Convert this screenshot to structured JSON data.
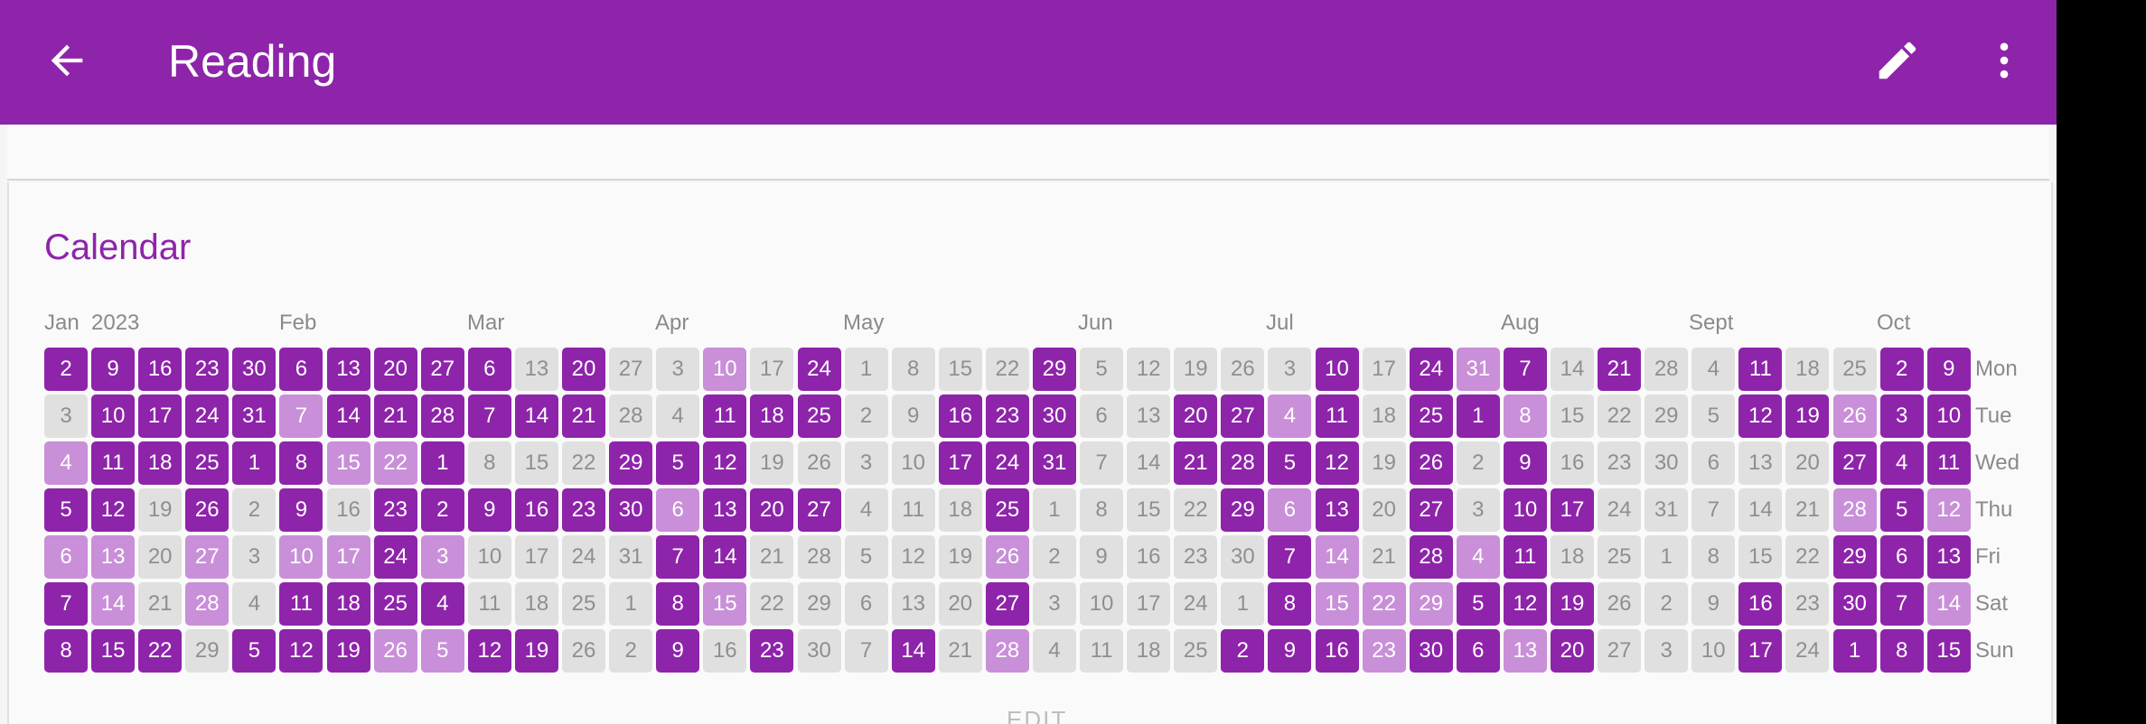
{
  "appbar": {
    "title": "Reading",
    "back_icon": "arrow-back-icon",
    "edit_icon": "pencil-icon",
    "more_icon": "more-vert-icon",
    "color": "#8e24aa"
  },
  "calendar": {
    "title": "Calendar",
    "year": "2023",
    "months": [
      "Jan",
      "Feb",
      "Mar",
      "Apr",
      "May",
      "Jun",
      "Jul",
      "Aug",
      "Sept",
      "Oct"
    ],
    "weekdays": [
      "Mon",
      "Tue",
      "Wed",
      "Thu",
      "Fri",
      "Sat",
      "Sun"
    ],
    "colors": {
      "done": "#8e24aa",
      "partial": "#c98fd8",
      "none": "#e0e0e0"
    },
    "levels_legend": "0 = not done (grey), 1 = partial (light purple), 2 = done (purple)",
    "weeks": [
      [
        [
          2,
          2
        ],
        [
          3,
          0
        ],
        [
          4,
          1
        ],
        [
          5,
          2
        ],
        [
          6,
          1
        ],
        [
          7,
          2
        ],
        [
          8,
          2
        ]
      ],
      [
        [
          9,
          2
        ],
        [
          10,
          2
        ],
        [
          11,
          2
        ],
        [
          12,
          2
        ],
        [
          13,
          1
        ],
        [
          14,
          1
        ],
        [
          15,
          2
        ]
      ],
      [
        [
          16,
          2
        ],
        [
          17,
          2
        ],
        [
          18,
          2
        ],
        [
          19,
          0
        ],
        [
          20,
          0
        ],
        [
          21,
          0
        ],
        [
          22,
          2
        ]
      ],
      [
        [
          23,
          2
        ],
        [
          24,
          2
        ],
        [
          25,
          2
        ],
        [
          26,
          2
        ],
        [
          27,
          1
        ],
        [
          28,
          1
        ],
        [
          29,
          0
        ]
      ],
      [
        [
          30,
          2
        ],
        [
          31,
          2
        ],
        [
          1,
          2
        ],
        [
          2,
          0
        ],
        [
          3,
          0
        ],
        [
          4,
          0
        ],
        [
          5,
          2
        ]
      ],
      [
        [
          6,
          2
        ],
        [
          7,
          1
        ],
        [
          8,
          2
        ],
        [
          9,
          2
        ],
        [
          10,
          1
        ],
        [
          11,
          2
        ],
        [
          12,
          2
        ]
      ],
      [
        [
          13,
          2
        ],
        [
          14,
          2
        ],
        [
          15,
          1
        ],
        [
          16,
          0
        ],
        [
          17,
          1
        ],
        [
          18,
          2
        ],
        [
          19,
          2
        ]
      ],
      [
        [
          20,
          2
        ],
        [
          21,
          2
        ],
        [
          22,
          1
        ],
        [
          23,
          2
        ],
        [
          24,
          2
        ],
        [
          25,
          2
        ],
        [
          26,
          1
        ]
      ],
      [
        [
          27,
          2
        ],
        [
          28,
          2
        ],
        [
          1,
          2
        ],
        [
          2,
          2
        ],
        [
          3,
          1
        ],
        [
          4,
          2
        ],
        [
          5,
          1
        ]
      ],
      [
        [
          6,
          2
        ],
        [
          7,
          2
        ],
        [
          8,
          0
        ],
        [
          9,
          2
        ],
        [
          10,
          0
        ],
        [
          11,
          0
        ],
        [
          12,
          2
        ]
      ],
      [
        [
          13,
          0
        ],
        [
          14,
          2
        ],
        [
          15,
          0
        ],
        [
          16,
          2
        ],
        [
          17,
          0
        ],
        [
          18,
          0
        ],
        [
          19,
          2
        ]
      ],
      [
        [
          20,
          2
        ],
        [
          21,
          2
        ],
        [
          22,
          0
        ],
        [
          23,
          2
        ],
        [
          24,
          0
        ],
        [
          25,
          0
        ],
        [
          26,
          0
        ]
      ],
      [
        [
          27,
          0
        ],
        [
          28,
          0
        ],
        [
          29,
          2
        ],
        [
          30,
          2
        ],
        [
          31,
          0
        ],
        [
          1,
          0
        ],
        [
          2,
          0
        ]
      ],
      [
        [
          3,
          0
        ],
        [
          4,
          0
        ],
        [
          5,
          2
        ],
        [
          6,
          1
        ],
        [
          7,
          2
        ],
        [
          8,
          2
        ],
        [
          9,
          2
        ]
      ],
      [
        [
          10,
          1
        ],
        [
          11,
          2
        ],
        [
          12,
          2
        ],
        [
          13,
          2
        ],
        [
          14,
          2
        ],
        [
          15,
          1
        ],
        [
          16,
          0
        ]
      ],
      [
        [
          17,
          0
        ],
        [
          18,
          2
        ],
        [
          19,
          0
        ],
        [
          20,
          2
        ],
        [
          21,
          0
        ],
        [
          22,
          0
        ],
        [
          23,
          2
        ]
      ],
      [
        [
          24,
          2
        ],
        [
          25,
          2
        ],
        [
          26,
          0
        ],
        [
          27,
          2
        ],
        [
          28,
          0
        ],
        [
          29,
          0
        ],
        [
          30,
          0
        ]
      ],
      [
        [
          1,
          0
        ],
        [
          2,
          0
        ],
        [
          3,
          0
        ],
        [
          4,
          0
        ],
        [
          5,
          0
        ],
        [
          6,
          0
        ],
        [
          7,
          0
        ]
      ],
      [
        [
          8,
          0
        ],
        [
          9,
          0
        ],
        [
          10,
          0
        ],
        [
          11,
          0
        ],
        [
          12,
          0
        ],
        [
          13,
          0
        ],
        [
          14,
          2
        ]
      ],
      [
        [
          15,
          0
        ],
        [
          16,
          2
        ],
        [
          17,
          2
        ],
        [
          18,
          0
        ],
        [
          19,
          0
        ],
        [
          20,
          0
        ],
        [
          21,
          0
        ]
      ],
      [
        [
          22,
          0
        ],
        [
          23,
          2
        ],
        [
          24,
          2
        ],
        [
          25,
          2
        ],
        [
          26,
          1
        ],
        [
          27,
          2
        ],
        [
          28,
          1
        ]
      ],
      [
        [
          29,
          2
        ],
        [
          30,
          2
        ],
        [
          31,
          2
        ],
        [
          1,
          0
        ],
        [
          2,
          0
        ],
        [
          3,
          0
        ],
        [
          4,
          0
        ]
      ],
      [
        [
          5,
          0
        ],
        [
          6,
          0
        ],
        [
          7,
          0
        ],
        [
          8,
          0
        ],
        [
          9,
          0
        ],
        [
          10,
          0
        ],
        [
          11,
          0
        ]
      ],
      [
        [
          12,
          0
        ],
        [
          13,
          0
        ],
        [
          14,
          0
        ],
        [
          15,
          0
        ],
        [
          16,
          0
        ],
        [
          17,
          0
        ],
        [
          18,
          0
        ]
      ],
      [
        [
          19,
          0
        ],
        [
          20,
          2
        ],
        [
          21,
          2
        ],
        [
          22,
          0
        ],
        [
          23,
          0
        ],
        [
          24,
          0
        ],
        [
          25,
          0
        ]
      ],
      [
        [
          26,
          0
        ],
        [
          27,
          2
        ],
        [
          28,
          2
        ],
        [
          29,
          2
        ],
        [
          30,
          0
        ],
        [
          1,
          0
        ],
        [
          2,
          2
        ]
      ],
      [
        [
          3,
          0
        ],
        [
          4,
          1
        ],
        [
          5,
          2
        ],
        [
          6,
          1
        ],
        [
          7,
          2
        ],
        [
          8,
          2
        ],
        [
          9,
          2
        ]
      ],
      [
        [
          10,
          2
        ],
        [
          11,
          2
        ],
        [
          12,
          2
        ],
        [
          13,
          2
        ],
        [
          14,
          1
        ],
        [
          15,
          1
        ],
        [
          16,
          2
        ]
      ],
      [
        [
          17,
          0
        ],
        [
          18,
          0
        ],
        [
          19,
          0
        ],
        [
          20,
          0
        ],
        [
          21,
          0
        ],
        [
          22,
          1
        ],
        [
          23,
          1
        ]
      ],
      [
        [
          24,
          2
        ],
        [
          25,
          2
        ],
        [
          26,
          2
        ],
        [
          27,
          2
        ],
        [
          28,
          2
        ],
        [
          29,
          1
        ],
        [
          30,
          2
        ]
      ],
      [
        [
          31,
          1
        ],
        [
          1,
          2
        ],
        [
          2,
          0
        ],
        [
          3,
          0
        ],
        [
          4,
          1
        ],
        [
          5,
          2
        ],
        [
          6,
          2
        ]
      ],
      [
        [
          7,
          2
        ],
        [
          8,
          1
        ],
        [
          9,
          2
        ],
        [
          10,
          2
        ],
        [
          11,
          2
        ],
        [
          12,
          2
        ],
        [
          13,
          1
        ]
      ],
      [
        [
          14,
          0
        ],
        [
          15,
          0
        ],
        [
          16,
          0
        ],
        [
          17,
          2
        ],
        [
          18,
          0
        ],
        [
          19,
          2
        ],
        [
          20,
          2
        ]
      ],
      [
        [
          21,
          2
        ],
        [
          22,
          0
        ],
        [
          23,
          0
        ],
        [
          24,
          0
        ],
        [
          25,
          0
        ],
        [
          26,
          0
        ],
        [
          27,
          0
        ]
      ],
      [
        [
          28,
          0
        ],
        [
          29,
          0
        ],
        [
          30,
          0
        ],
        [
          31,
          0
        ],
        [
          1,
          0
        ],
        [
          2,
          0
        ],
        [
          3,
          0
        ]
      ],
      [
        [
          4,
          0
        ],
        [
          5,
          0
        ],
        [
          6,
          0
        ],
        [
          7,
          0
        ],
        [
          8,
          0
        ],
        [
          9,
          0
        ],
        [
          10,
          0
        ]
      ],
      [
        [
          11,
          2
        ],
        [
          12,
          2
        ],
        [
          13,
          0
        ],
        [
          14,
          0
        ],
        [
          15,
          0
        ],
        [
          16,
          2
        ],
        [
          17,
          2
        ]
      ],
      [
        [
          18,
          0
        ],
        [
          19,
          2
        ],
        [
          20,
          0
        ],
        [
          21,
          0
        ],
        [
          22,
          0
        ],
        [
          23,
          0
        ],
        [
          24,
          0
        ]
      ],
      [
        [
          25,
          0
        ],
        [
          26,
          1
        ],
        [
          27,
          2
        ],
        [
          28,
          1
        ],
        [
          29,
          2
        ],
        [
          30,
          2
        ],
        [
          1,
          2
        ]
      ],
      [
        [
          2,
          2
        ],
        [
          3,
          2
        ],
        [
          4,
          2
        ],
        [
          5,
          2
        ],
        [
          6,
          2
        ],
        [
          7,
          2
        ],
        [
          8,
          2
        ]
      ],
      [
        [
          9,
          2
        ],
        [
          10,
          2
        ],
        [
          11,
          2
        ],
        [
          12,
          1
        ],
        [
          13,
          2
        ],
        [
          14,
          1
        ],
        [
          15,
          2
        ]
      ]
    ]
  },
  "footer": {
    "edit_label": "EDIT"
  }
}
